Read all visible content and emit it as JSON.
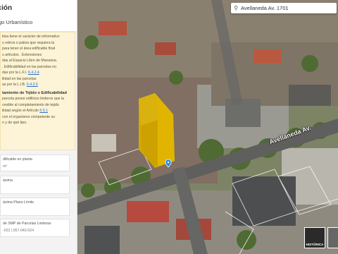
{
  "sidebar": {
    "title": "ación",
    "subtitle": "go Urbanístico",
    "notice_lines": [
      "itiva tiene el carácter de informativo",
      "s retiros o patios que requiera la",
      "para tener el área edificable final",
      "s artículos . Extensiones",
      "das al Espacio Libre de Manzana.",
      ". Edificabilidad en las parcelas no"
    ],
    "notice_ref1_prefix": "das por la L.F.I.",
    "notice_ref1": "6.4.2.4",
    "notice_ref2_prefix": "ilidad en las parcelas",
    "notice_ref2": "",
    "notice_ref3_prefix": "as por la L.I.B.",
    "notice_ref3": "6.4.3.5",
    "section_heading": "tamiento de Tejido o Edificabilidad",
    "section_lines": [
      "parcela posee edificios linderos que la",
      "cesible al completamiento de tejido",
      "ilidad según el Artículo"
    ],
    "section_ref": "6.5.1",
    "section_tail": [
      "con el organismo competente su",
      "n y de qué tipo."
    ],
    "card1_label": "dificable en planta",
    "card1_value": "m²",
    "card2_label": "áxima",
    "card3_label": "áxima Plano Límite",
    "card4_label": "de SMP de Parcelas Linderas",
    "card4_value": "-022 | 057-043-024"
  },
  "search": {
    "value": "Avellaneda Av. 1701"
  },
  "map": {
    "street_label": "Avellaneda Av.",
    "layer_toggle_label": "HISTÓRICA"
  },
  "colors": {
    "building_highlight": "#e6b800",
    "marker": "#1e88e5",
    "notice_bg": "#fdf3d6",
    "link": "#1e6fd0"
  }
}
